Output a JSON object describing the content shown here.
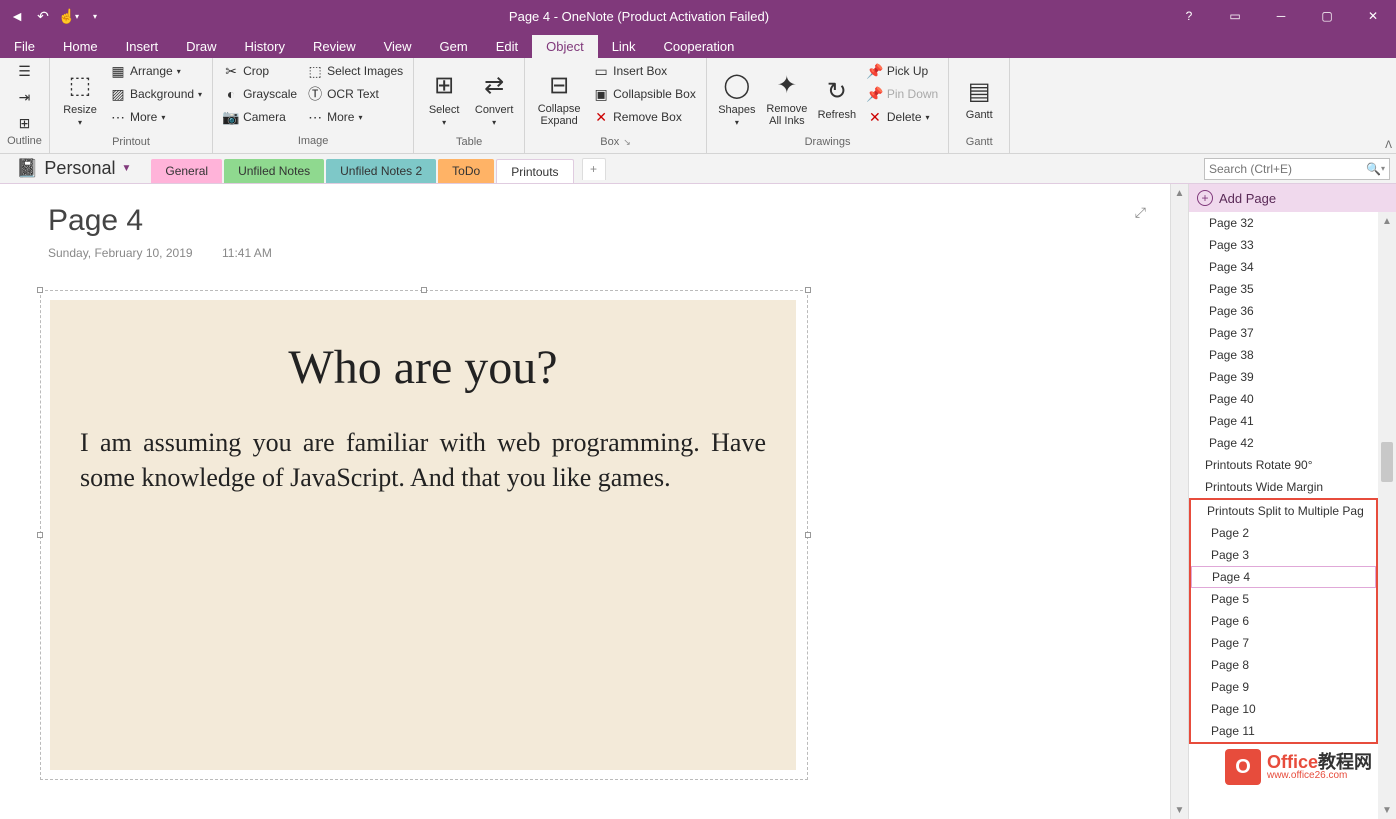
{
  "titlebar": {
    "title": "Page 4 - OneNote (Product Activation Failed)"
  },
  "menutabs": [
    "File",
    "Home",
    "Insert",
    "Draw",
    "History",
    "Review",
    "View",
    "Gem",
    "Edit",
    "Object",
    "Link",
    "Cooperation"
  ],
  "active_menutab": 9,
  "ribbon": {
    "outline": {
      "label": "Outline"
    },
    "printout": {
      "label": "Printout",
      "resize": "Resize",
      "arrange": "Arrange",
      "background": "Background",
      "more": "More"
    },
    "image": {
      "label": "Image",
      "crop": "Crop",
      "grayscale": "Grayscale",
      "camera": "Camera",
      "select": "Select Images",
      "ocr": "OCR Text",
      "more": "More"
    },
    "table": {
      "label": "Table",
      "select": "Select",
      "convert": "Convert"
    },
    "box": {
      "label": "Box",
      "collapse": "Collapse Expand",
      "insert": "Insert Box",
      "collapsible": "Collapsible Box",
      "remove": "Remove Box"
    },
    "drawings": {
      "label": "Drawings",
      "shapes": "Shapes",
      "remove_inks": "Remove All Inks",
      "refresh": "Refresh",
      "pickup": "Pick Up",
      "pindown": "Pin Down",
      "delete": "Delete"
    },
    "gantt": {
      "label": "Gantt",
      "gantt": "Gantt"
    }
  },
  "notebook": {
    "name": "Personal"
  },
  "section_tabs": [
    {
      "label": "General",
      "cls": "pink"
    },
    {
      "label": "Unfiled Notes",
      "cls": "green"
    },
    {
      "label": "Unfiled Notes 2",
      "cls": "teal"
    },
    {
      "label": "ToDo",
      "cls": "orange"
    },
    {
      "label": "Printouts",
      "cls": "active"
    }
  ],
  "search": {
    "placeholder": "Search (Ctrl+E)"
  },
  "page": {
    "title": "Page 4",
    "date": "Sunday, February 10, 2019",
    "time": "11:41 AM",
    "printout_heading": "Who are you?",
    "printout_body": "I am assuming you are familiar with web programming. Have some knowledge of JavaScript. And that you like games."
  },
  "page_panel": {
    "add": "Add Page",
    "items": [
      {
        "label": "Page 32",
        "sub": true
      },
      {
        "label": "Page 33",
        "sub": true
      },
      {
        "label": "Page 34",
        "sub": true
      },
      {
        "label": "Page 35",
        "sub": true
      },
      {
        "label": "Page 36",
        "sub": true
      },
      {
        "label": "Page 37",
        "sub": true
      },
      {
        "label": "Page 38",
        "sub": true
      },
      {
        "label": "Page 39",
        "sub": true
      },
      {
        "label": "Page 40",
        "sub": true
      },
      {
        "label": "Page 41",
        "sub": true
      },
      {
        "label": "Page 42",
        "sub": true
      },
      {
        "label": "Printouts Rotate 90°"
      },
      {
        "label": "Printouts Wide Margin"
      },
      {
        "label": "Printouts Split to Multiple Pag",
        "red": true
      },
      {
        "label": "Page 2",
        "sub": true,
        "red": true
      },
      {
        "label": "Page 3",
        "sub": true,
        "red": true
      },
      {
        "label": "Page 4",
        "sub": true,
        "red": true,
        "current": true
      },
      {
        "label": "Page 5",
        "sub": true,
        "red": true
      },
      {
        "label": "Page 6",
        "sub": true,
        "red": true
      },
      {
        "label": "Page 7",
        "sub": true,
        "red": true
      },
      {
        "label": "Page 8",
        "sub": true,
        "red": true
      },
      {
        "label": "Page 9",
        "sub": true,
        "red": true
      },
      {
        "label": "Page 10",
        "sub": true,
        "red": true
      },
      {
        "label": "Page 11",
        "sub": true,
        "red": true
      }
    ]
  },
  "watermark": {
    "name_pre": "Office",
    "name_post": "教程网",
    "url": "www.office26.com"
  }
}
